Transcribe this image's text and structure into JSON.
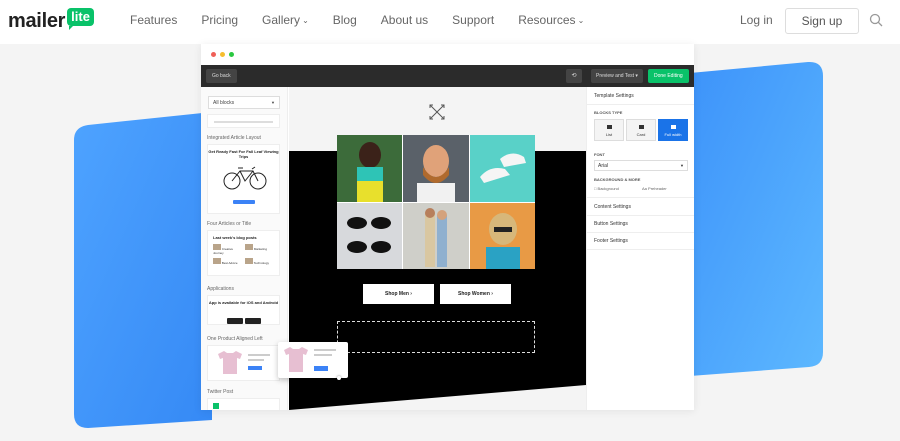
{
  "brand": {
    "logo_main": "mailer",
    "logo_badge": "lite",
    "accent_green": "#09c269",
    "accent_blue": "#3b9bff"
  },
  "nav": {
    "links": [
      {
        "label": "Features"
      },
      {
        "label": "Pricing"
      },
      {
        "label": "Gallery",
        "has_dropdown": true
      },
      {
        "label": "Blog"
      },
      {
        "label": "About us"
      },
      {
        "label": "Support"
      },
      {
        "label": "Resources",
        "has_dropdown": true
      }
    ],
    "login": "Log in",
    "signup": "Sign up",
    "search_icon": "search-icon"
  },
  "editor": {
    "toolbar": {
      "go_back": "Go back",
      "undo_icon": "undo-icon",
      "preview": "Preview and Test",
      "done": "Done Editing"
    },
    "left_panel": {
      "select_value": "All blocks",
      "categories": [
        {
          "title": "Integrated Article Layout",
          "card_title": "Get Ready Fast For Fall Leaf Viewing Trips"
        },
        {
          "title": "Four Articles or Title",
          "card_title": "Last week's blog posts"
        },
        {
          "title": "Applications",
          "card_title": "App is available for iOS and Android"
        },
        {
          "title": "One Product Aligned Left",
          "card_title": "Loremipsum product name"
        },
        {
          "title": "Twitter Post"
        }
      ],
      "four_articles_items": [
        "Creative Journey",
        "Marketing",
        "Best Advice",
        "Technology"
      ]
    },
    "canvas": {
      "buttons": [
        "Shop Men",
        "Shop Women"
      ]
    },
    "right_panel": {
      "template_settings": "Template Settings",
      "blocks_type_label": "BLOCKS TYPE",
      "block_types": [
        {
          "label": "List"
        },
        {
          "label": "Card"
        },
        {
          "label": "Full width",
          "active": true
        }
      ],
      "font_label": "FONT",
      "font_value": "Arial",
      "background_label": "BACKGROUND & MORE",
      "background_option": "Background",
      "preheader_option": "Preheader",
      "preheader_prefix": "Aa",
      "sections": [
        "Content Settings",
        "Button Settings",
        "Footer Settings"
      ]
    }
  }
}
